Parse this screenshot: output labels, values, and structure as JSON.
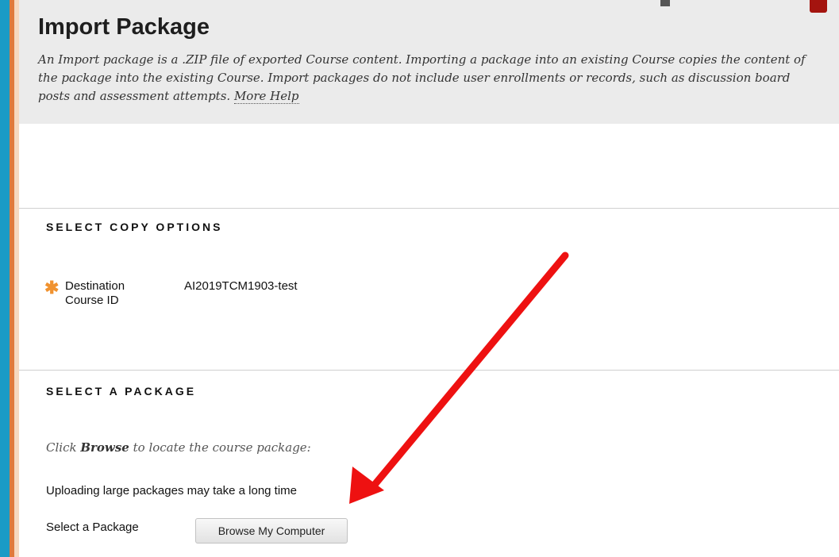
{
  "header": {
    "title": "Import Package",
    "description": "An Import package is a .ZIP file of exported Course content. Importing a package into an existing Course copies the content of the package into the existing Course. Import packages do not include user enrollments or records, such as discussion board posts and assessment attempts.",
    "help_link": "More Help"
  },
  "copy_options": {
    "section_title": "SELECT COPY OPTIONS",
    "required_mark": "✱",
    "destination_label": "Destination Course ID",
    "destination_value": "AI2019TCM1903-test"
  },
  "package": {
    "section_title": "SELECT A PACKAGE",
    "hint_prefix": "Click ",
    "hint_bold": "Browse",
    "hint_suffix": " to locate the course package:",
    "upload_note": "Uploading large packages may take a long time",
    "select_label": "Select a Package",
    "browse_button": "Browse My Computer"
  },
  "colors": {
    "accent_blue": "#1a9bc6",
    "accent_orange": "#e07a3c",
    "required_star": "#f0922f",
    "annotation_arrow": "#ee1111"
  }
}
